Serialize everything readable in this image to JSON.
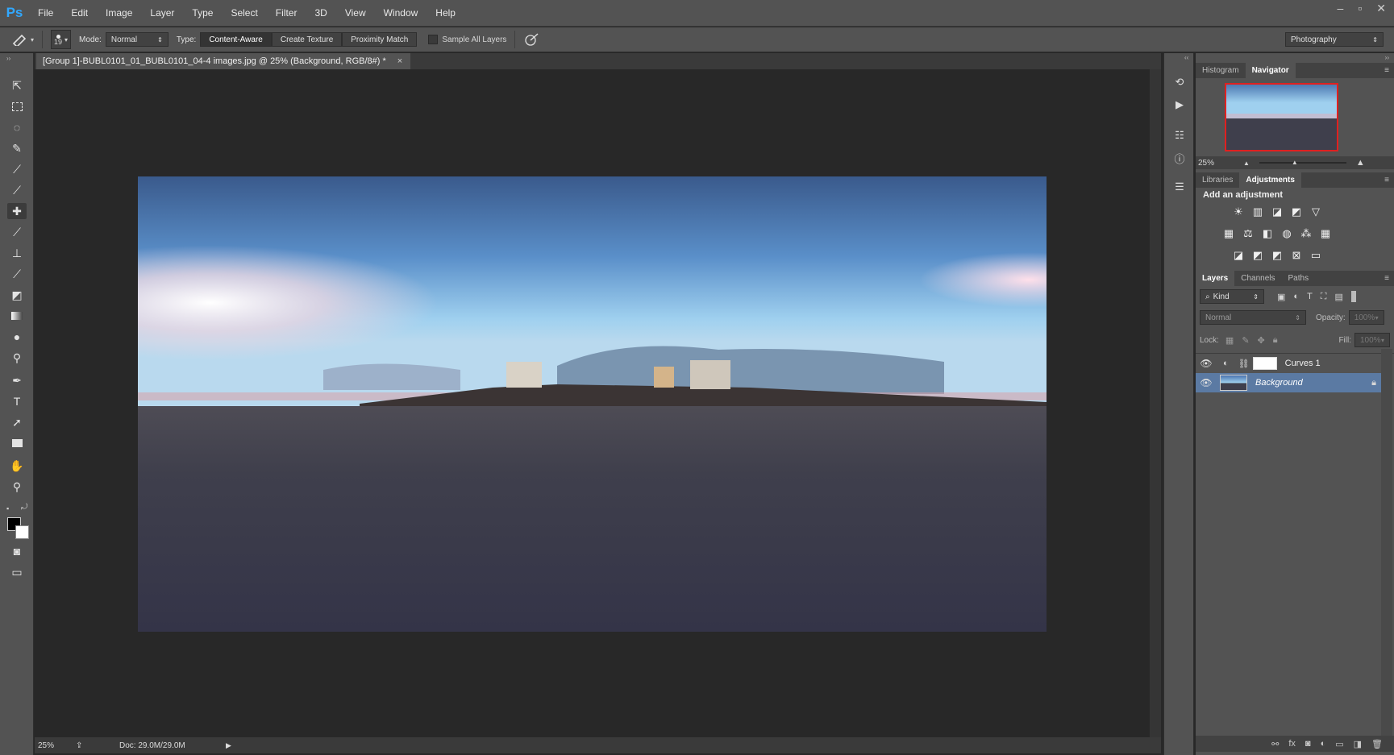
{
  "app": {
    "logo": "Ps"
  },
  "menu": [
    "File",
    "Edit",
    "Image",
    "Layer",
    "Type",
    "Select",
    "Filter",
    "3D",
    "View",
    "Window",
    "Help"
  ],
  "window_controls": [
    "–",
    "▫",
    "✕"
  ],
  "options": {
    "brush_size": "19",
    "mode_label": "Mode:",
    "mode_value": "Normal",
    "type_label": "Type:",
    "type_options": [
      "Content-Aware",
      "Create Texture",
      "Proximity Match"
    ],
    "sample_all_layers": "Sample All Layers",
    "workspace": "Photography"
  },
  "document": {
    "tab_title": "[Group 1]-BUBL0101_01_BUBL0101_04-4 images.jpg @ 25% (Background, RGB/8#) *",
    "close": "×",
    "zoom": "25%",
    "doc_size": "Doc: 29.0M/29.0M"
  },
  "panels": {
    "top_tabs": [
      "Histogram",
      "Navigator"
    ],
    "navigator_zoom": "25%",
    "mid_tabs": [
      "Libraries",
      "Adjustments"
    ],
    "adjustments_title": "Add an adjustment",
    "layers_tabs": [
      "Layers",
      "Channels",
      "Paths"
    ],
    "filter_kind": "Kind",
    "blend_mode": "Normal",
    "opacity_label": "Opacity:",
    "opacity_value": "100%",
    "lock_label": "Lock:",
    "fill_label": "Fill:",
    "fill_value": "100%",
    "layers": [
      {
        "name": "Curves 1"
      },
      {
        "name": "Background"
      }
    ]
  },
  "colors": {
    "chrome": "#535353",
    "canvas_bg": "#282828",
    "selected_layer": "#5b7aa3",
    "accent": "#31a8ff"
  }
}
